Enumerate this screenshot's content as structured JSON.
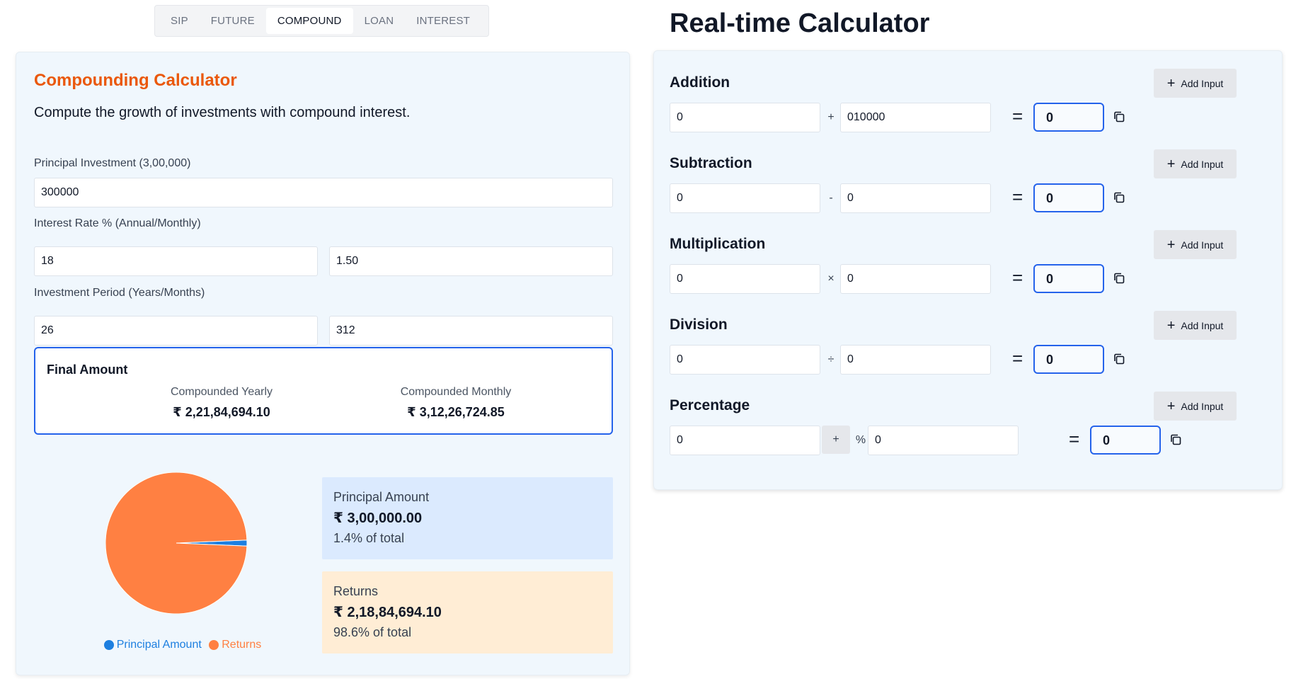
{
  "tabs": [
    "SIP",
    "FUTURE",
    "COMPOUND",
    "LOAN",
    "INTEREST"
  ],
  "active_tab": "COMPOUND",
  "compound": {
    "title": "Compounding Calculator",
    "description": "Compute the growth of investments with compound interest.",
    "principal_label": "Principal Investment (3,00,000)",
    "principal_value": "300000",
    "rate_label": "Interest Rate % (Annual/Monthly)",
    "rate_annual": "18",
    "rate_monthly": "1.50",
    "period_label": "Investment Period (Years/Months)",
    "period_years": "26",
    "period_months": "312",
    "final": {
      "title": "Final Amount",
      "yearly_label": "Compounded Yearly",
      "yearly_value": "₹ 2,21,84,694.10",
      "monthly_label": "Compounded Monthly",
      "monthly_value": "₹ 3,12,26,724.85"
    },
    "breakdown": {
      "principal_label": "Principal Amount",
      "principal_value": "₹ 3,00,000.00",
      "principal_pct": "1.4% of total",
      "returns_label": "Returns",
      "returns_value": "₹ 2,18,84,694.10",
      "returns_pct": "98.6% of total"
    },
    "chart_data": {
      "type": "pie",
      "labels": [
        "Principal Amount",
        "Returns"
      ],
      "values": [
        300000,
        21884694.1
      ],
      "percentages": [
        1.4,
        98.6
      ],
      "colors": [
        "#1d7fe0",
        "#ff8042"
      ],
      "legend_position": "bottom"
    },
    "colors": {
      "title": "#ea580c",
      "principal": "#1d7fe0",
      "returns": "#ff8042",
      "accent": "#2563eb"
    }
  },
  "realtime": {
    "title": "Real-time Calculator",
    "add_input_label": "Add Input",
    "operations": [
      {
        "title": "Addition",
        "a": "0",
        "op": "+",
        "b": "010000",
        "result": "0"
      },
      {
        "title": "Subtraction",
        "a": "0",
        "op": "-",
        "b": "0",
        "result": "0"
      },
      {
        "title": "Multiplication",
        "a": "0",
        "op": "×",
        "b": "0",
        "result": "0"
      },
      {
        "title": "Division",
        "a": "0",
        "op": "÷",
        "b": "0",
        "result": "0"
      }
    ],
    "percentage": {
      "title": "Percentage",
      "a": "0",
      "toggle": "+",
      "op": "%",
      "b": "0",
      "result": "0"
    },
    "equals": "=",
    "icons": {
      "add": "plus-icon",
      "copy": "copy-icon"
    }
  }
}
